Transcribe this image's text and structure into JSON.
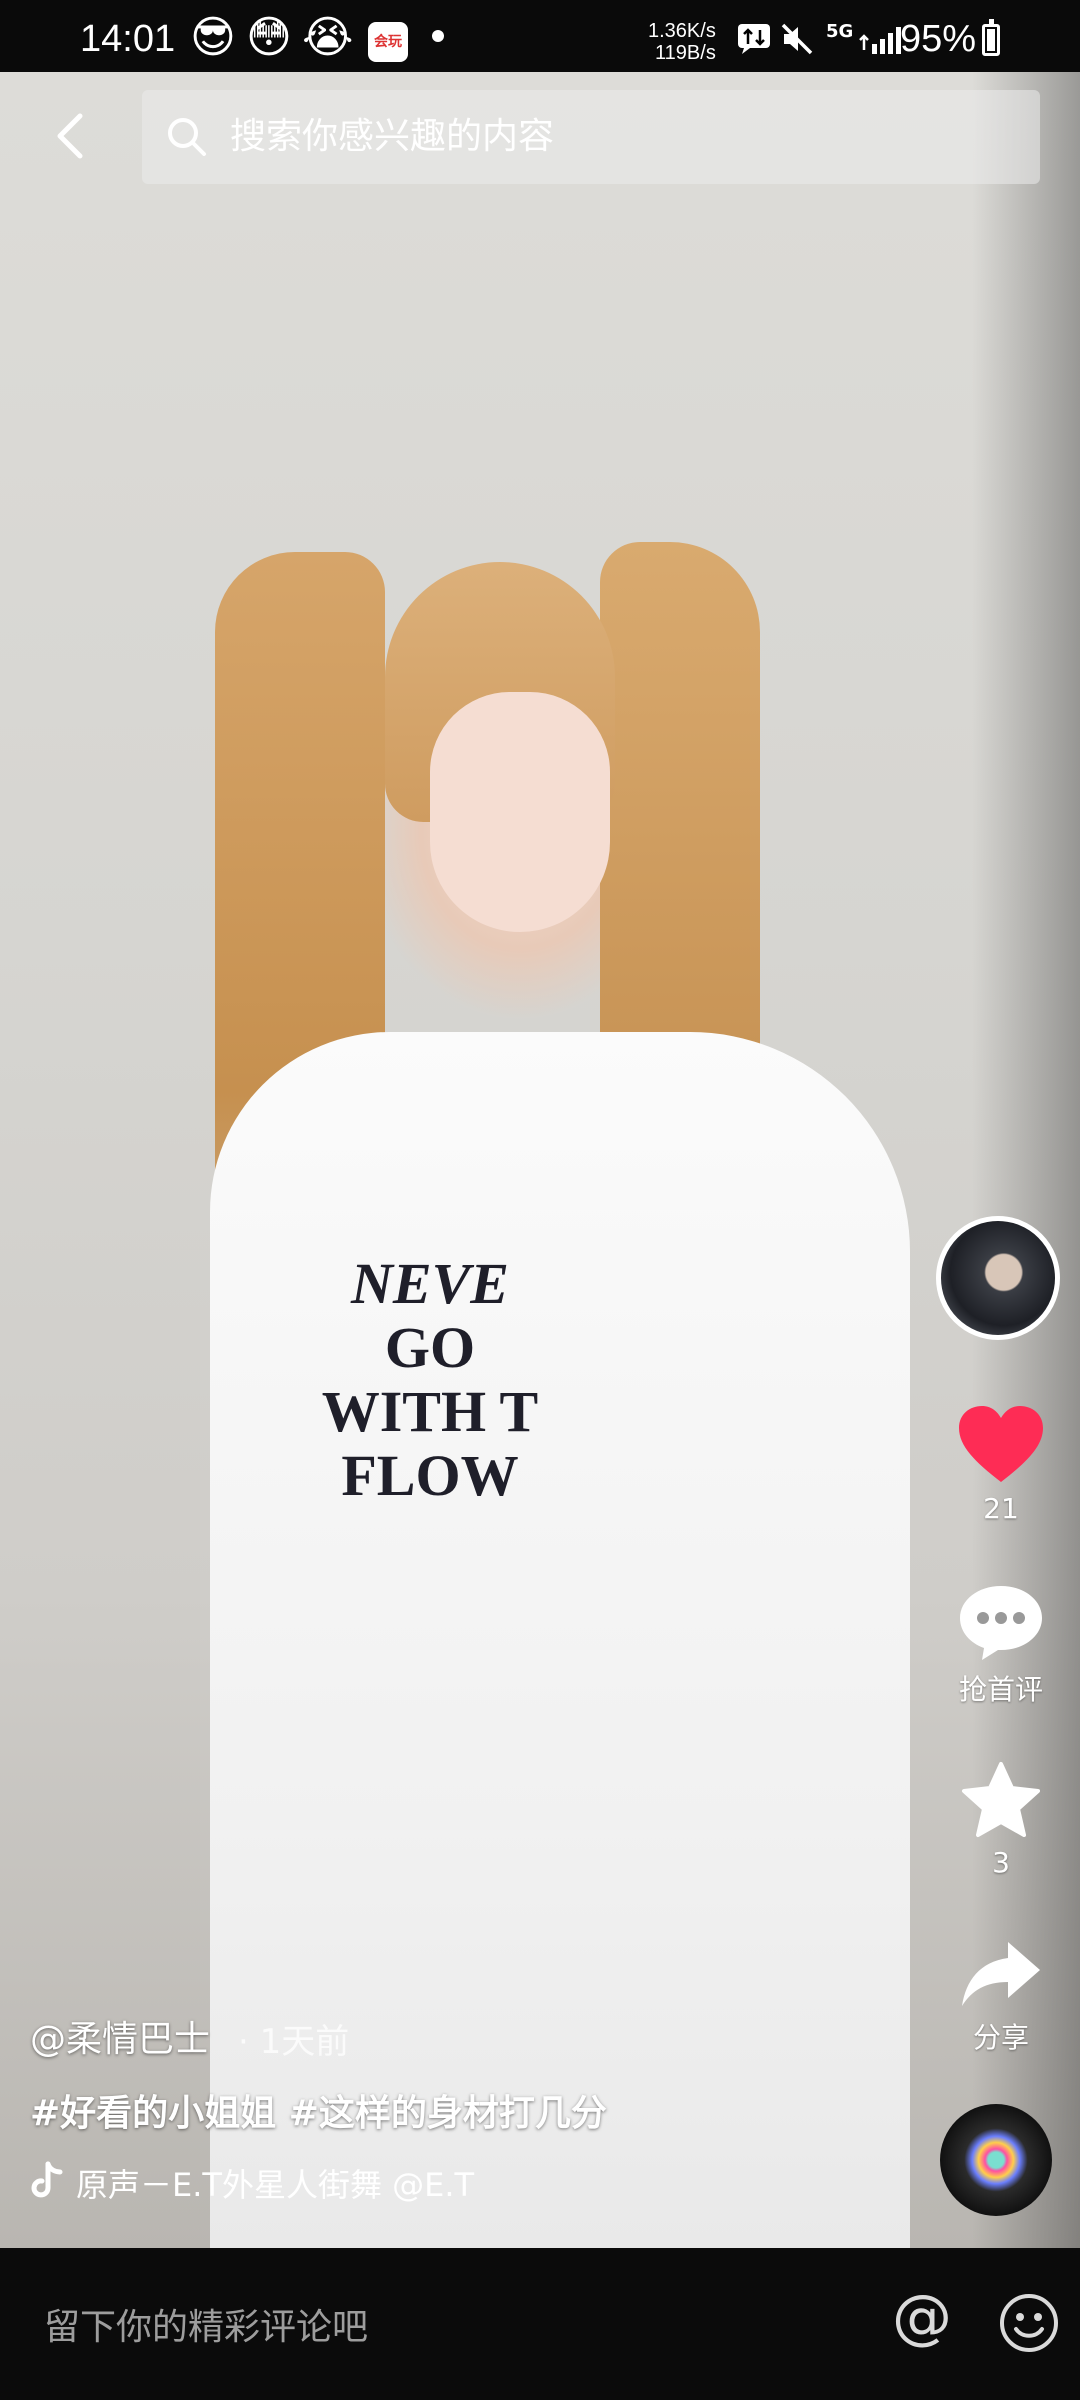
{
  "status_bar": {
    "time": "14:01",
    "emojis": [
      "😎",
      "😳",
      "😭"
    ],
    "app_badge": "会玩",
    "net_up": "1.36K/s",
    "net_down": "119B/s",
    "network_type": "5G",
    "battery": "95%"
  },
  "search": {
    "placeholder": "搜索你感兴趣的内容"
  },
  "video": {
    "shirt_lines": [
      "NEVE",
      "GO",
      "WITH T",
      "FLOW"
    ]
  },
  "rail": {
    "likes": "21",
    "comment_label": "抢首评",
    "favorites": "3",
    "share_label": "分享"
  },
  "caption": {
    "author": "@柔情巴士",
    "age": "· 1天前",
    "tags": "#好看的小姐姐 #这样的身材打几分",
    "music": "原声－E.T外星人街舞    @E.T"
  },
  "comment_bar": {
    "placeholder": "留下你的精彩评论吧",
    "at_symbol": "@"
  },
  "colors": {
    "like": "#fe2c55",
    "background": "#000000"
  }
}
